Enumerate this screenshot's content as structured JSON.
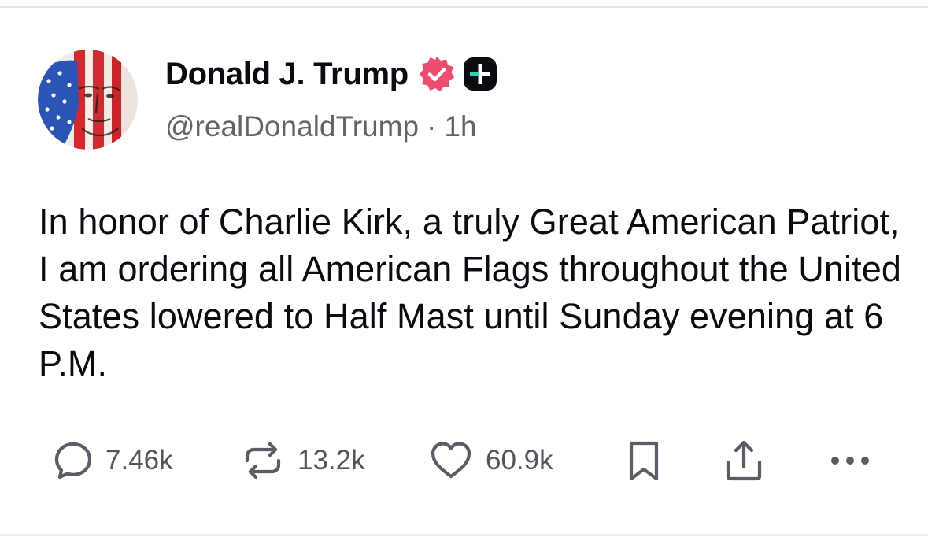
{
  "author": {
    "display_name": "Donald J. Trump",
    "handle": "@realDonaldTrump",
    "separator": "·",
    "time_ago": "1h",
    "avatar_icon": "flag-portrait-avatar",
    "verified_icon": "verified-badge-icon",
    "verified_color": "#f04a6e",
    "plus_badge_icon": "plus-badge-icon"
  },
  "post": {
    "text": "In honor of Charlie Kirk, a truly Great American Patriot, I am ordering all American Flags throughout the United States lowered to Half Mast until Sunday evening at 6 P.M."
  },
  "actions": {
    "replies": {
      "icon": "reply-icon",
      "count": "7.46k"
    },
    "reposts": {
      "icon": "repost-icon",
      "count": "13.2k"
    },
    "likes": {
      "icon": "heart-icon",
      "count": "60.9k"
    },
    "bookmark": {
      "icon": "bookmark-icon"
    },
    "share": {
      "icon": "share-icon"
    },
    "more": {
      "icon": "more-icon"
    }
  },
  "colors": {
    "text_primary": "#0b0b12",
    "text_secondary": "#63636e",
    "icon_gray": "#5c5c66",
    "badge_teal": "#2fd3b6"
  }
}
